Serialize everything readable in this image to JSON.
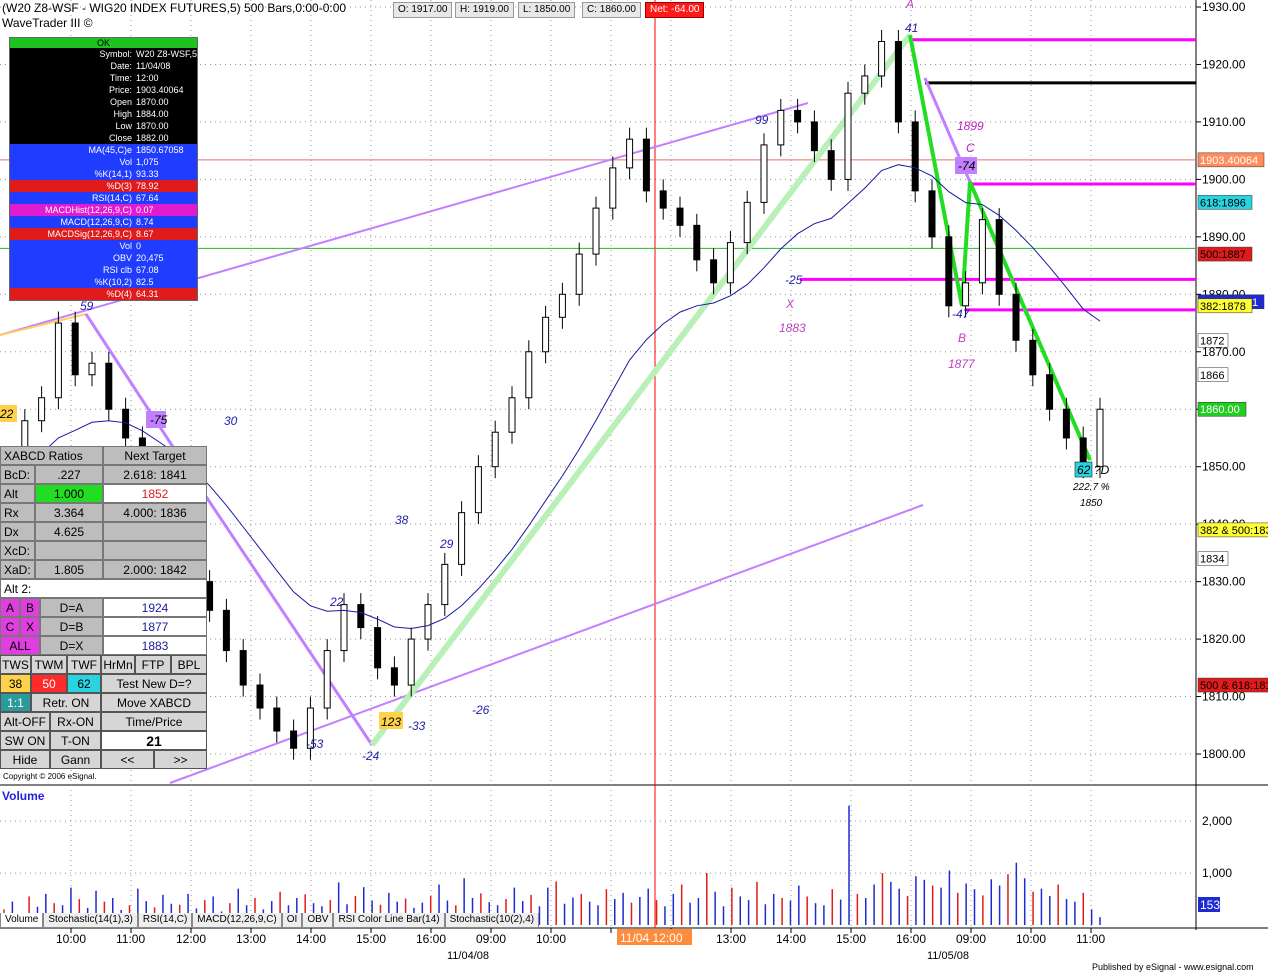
{
  "header": {
    "title": "(W20 Z8-WSF - WIG20 INDEX FUTURES,5) 500 Bars,0:00-0:00",
    "subtitle": "WaveTrader III ©",
    "open": "O: 1917.00",
    "high": "H: 1919.00",
    "low": "L: 1850.00",
    "close": "C: 1860.00",
    "net": "Net: -64.00"
  },
  "data_window": {
    "status": "OK",
    "rows": [
      {
        "k": "Symbol:",
        "v": "W20 Z8-WSF,5",
        "bg": "#000",
        "fg": "#fff"
      },
      {
        "k": "Date:",
        "v": "11/04/08",
        "bg": "#000",
        "fg": "#fff"
      },
      {
        "k": "Time:",
        "v": "12:00",
        "bg": "#000",
        "fg": "#fff"
      },
      {
        "k": "Price:",
        "v": "1903.40064",
        "bg": "#000",
        "fg": "#fff"
      },
      {
        "k": "Open",
        "v": "1870.00",
        "bg": "#000",
        "fg": "#fff"
      },
      {
        "k": "High",
        "v": "1884.00",
        "bg": "#000",
        "fg": "#fff"
      },
      {
        "k": "Low",
        "v": "1870.00",
        "bg": "#000",
        "fg": "#fff"
      },
      {
        "k": "Close",
        "v": "1882.00",
        "bg": "#000",
        "fg": "#fff"
      },
      {
        "k": "MA(45,C)e",
        "v": "1850.67058",
        "bg": "#1f3cff",
        "fg": "#fff"
      },
      {
        "k": "Vol",
        "v": "1,075",
        "bg": "#1f3cff",
        "fg": "#fff"
      },
      {
        "k": "%K(14,1)",
        "v": "93.33",
        "bg": "#1f3cff",
        "fg": "#fff"
      },
      {
        "k": "%D(3)",
        "v": "78.92",
        "bg": "#e01b1b",
        "fg": "#fff"
      },
      {
        "k": "RSI(14,C)",
        "v": "67.64",
        "bg": "#1f3cff",
        "fg": "#fff"
      },
      {
        "k": "MACDHist(12,26,9,C)",
        "v": "0.07",
        "bg": "#e01bd0",
        "fg": "#fff"
      },
      {
        "k": "MACD(12,26,9,C)",
        "v": "8.74",
        "bg": "#1f3cff",
        "fg": "#fff"
      },
      {
        "k": "MACDSig(12,26,9,C)",
        "v": "8.67",
        "bg": "#e01b1b",
        "fg": "#fff"
      },
      {
        "k": "Vol",
        "v": "0",
        "bg": "#1f3cff",
        "fg": "#fff"
      },
      {
        "k": "OBV",
        "v": "20,475",
        "bg": "#1f3cff",
        "fg": "#fff"
      },
      {
        "k": "RSI clb",
        "v": "67.08",
        "bg": "#1f3cff",
        "fg": "#fff"
      },
      {
        "k": "%K(10,2)",
        "v": "82.5",
        "bg": "#1f3cff",
        "fg": "#fff"
      },
      {
        "k": "%D(4)",
        "v": "64.31",
        "bg": "#e01b1b",
        "fg": "#fff"
      }
    ]
  },
  "xabcd": {
    "header_left": "XABCD Ratios",
    "header_right": "Next Target",
    "rows": [
      {
        "label": "BcD:",
        "val": ".227",
        "tgt": "2.618: 1841"
      },
      {
        "label": "Alt",
        "val": "1.000",
        "tgt": "1852"
      },
      {
        "label": "Rx",
        "val": "3.364",
        "tgt": "4.000: 1836"
      },
      {
        "label": "Dx",
        "val": "4.625",
        "tgt": ""
      },
      {
        "label": "XcD:",
        "val": "",
        "tgt": ""
      },
      {
        "label": "XaD:",
        "val": "1.805",
        "tgt": "2.000: 1842"
      }
    ],
    "alt2": "Alt 2:",
    "da_btn1": "A",
    "da_btn2": "B",
    "da_label": "D=A",
    "da_val": "1924",
    "db_btn1": "C",
    "db_btn2": "X",
    "db_label": "D=B",
    "db_val": "1877",
    "dx_btn1": "ALL",
    "dx_label": "D=X",
    "dx_val": "1883",
    "tabs": [
      "TWS",
      "TWM",
      "TWF",
      "HrMn",
      "FTP",
      "BPL"
    ],
    "n38": "38",
    "n50": "50",
    "n62": "62",
    "test_new": "Test New D=?",
    "ratio11": "1:1",
    "retr_on": "Retr. ON",
    "move_xabcd": "Move XABCD",
    "alt_off": "Alt-OFF",
    "rx_on": "Rx-ON",
    "time_price": "Time/Price",
    "sw_on": "SW ON",
    "t_on": "T-ON",
    "counter": "21",
    "hide": "Hide",
    "gann": "Gann",
    "prev": "<<",
    "next": ">>",
    "copyright": "Copyright © 2006 eSignal."
  },
  "chart_data": {
    "type": "line",
    "subtype": "candlestick",
    "title": "(W20 Z8-WSF - WIG20 INDEX FUTURES,5) 500 Bars,0:00-0:00",
    "ylim": [
      1795,
      1932
    ],
    "y_ticks": [
      "1930.00",
      "1920.00",
      "1910.00",
      "1900.00",
      "1890.00",
      "1880.00",
      "1870.00",
      "1860.00",
      "1850.00",
      "1840.00",
      "1830.00",
      "1820.00",
      "1810.00",
      "1800.00"
    ],
    "x_ticks": [
      "10:00",
      "11:00",
      "12:00",
      "13:00",
      "14:00",
      "15:00",
      "16:00",
      "09:00",
      "10:00",
      "11:00",
      "12:00",
      "13:00",
      "14:00",
      "15:00",
      "16:00",
      "09:00",
      "10:00",
      "11:00"
    ],
    "x_dates": [
      "11/04/08",
      "11/05/08"
    ],
    "cursor_time": "11/04 12:00",
    "price_labels": [
      {
        "text": "1903.40064",
        "price": 1903.4,
        "bg": "#ff8c5a",
        "fg": "#fff"
      },
      {
        "text": "618:1896",
        "price": 1896,
        "bg": "#2ad3e0",
        "fg": "#000"
      },
      {
        "text": "500:1887",
        "price": 1887,
        "bg": "#e01b1b",
        "fg": "#000"
      },
      {
        "text": "1878.67261",
        "price": 1878.7,
        "bg": "#1f2bd0",
        "fg": "#fff"
      },
      {
        "text": "382:1878",
        "price": 1878,
        "bg": "#ffff33",
        "fg": "#000"
      },
      {
        "text": "1872",
        "price": 1872,
        "bg": "#fff",
        "fg": "#000"
      },
      {
        "text": "1866",
        "price": 1866,
        "bg": "#fff",
        "fg": "#000"
      },
      {
        "text": "1860.00",
        "price": 1860,
        "bg": "#22cc22",
        "fg": "#fff"
      },
      {
        "text": "382 & 500:1839",
        "price": 1839,
        "bg": "#ffff33",
        "fg": "#000"
      },
      {
        "text": "1834",
        "price": 1834,
        "bg": "#fff",
        "fg": "#000"
      },
      {
        "text": "500 & 618:1812",
        "price": 1812,
        "bg": "#e01b1b",
        "fg": "#000"
      }
    ],
    "wave_labels": [
      "A",
      "41",
      "99",
      "1899",
      "C",
      "-74",
      "-25",
      "X",
      "1883",
      "-47",
      "B",
      "1877",
      "59",
      "-75",
      "30",
      "22",
      "38",
      "29",
      "-53",
      "-24",
      "-33",
      "-26",
      "?D",
      "222.7 %",
      "1850",
      "62",
      "22",
      "123"
    ],
    "series": [
      {
        "values": [
          1850,
          1858,
          1862,
          1875,
          1866,
          1868,
          1860,
          1855,
          1846,
          1840,
          1838,
          1830,
          1825,
          1818,
          1812,
          1808,
          1804,
          1801,
          1808,
          1818,
          1826,
          1822,
          1815,
          1812,
          1820,
          1826,
          1833,
          1842,
          1850,
          1856,
          1862,
          1870,
          1876,
          1880,
          1887,
          1895,
          1902,
          1907,
          1898,
          1895,
          1892,
          1886,
          1882,
          1889,
          1896,
          1906,
          1912,
          1910,
          1905,
          1900,
          1915,
          1918,
          1924,
          1910,
          1898,
          1890,
          1878,
          1882,
          1893,
          1880,
          1872,
          1866,
          1860,
          1855,
          1850,
          1860
        ]
      }
    ],
    "volume": {
      "title": "Volume",
      "y_ticks": [
        "2,000",
        "1,000"
      ],
      "ylim": [
        0,
        2600
      ],
      "last": "153",
      "values": [
        300,
        450,
        200,
        550,
        350,
        600,
        420,
        380,
        720,
        500,
        330,
        660,
        450,
        520,
        290,
        380,
        700,
        460,
        340,
        580,
        410,
        390,
        600,
        320,
        480,
        550,
        260,
        420,
        700,
        380,
        520,
        300,
        460,
        640,
        380,
        520,
        590,
        420,
        360,
        480,
        820,
        400,
        560,
        730,
        470,
        390,
        620,
        450,
        510,
        330,
        430,
        560,
        780,
        470,
        380,
        900,
        520,
        610,
        440,
        380,
        500,
        720,
        460,
        580,
        360,
        720,
        840,
        410,
        530,
        600,
        450,
        380,
        690,
        500,
        620,
        430,
        540,
        700,
        480,
        360,
        600,
        780,
        430,
        520,
        1000,
        640,
        360,
        720,
        550,
        480,
        830,
        400,
        600,
        520,
        470,
        760,
        550,
        420,
        380,
        690,
        490,
        2300,
        600,
        520,
        780,
        1000,
        830,
        700,
        560,
        940,
        870,
        760,
        720,
        1050,
        620,
        800,
        690,
        570,
        880,
        760,
        980,
        1200,
        900,
        640,
        700,
        560,
        780,
        500,
        450,
        620,
        300,
        150
      ]
    },
    "tabs": [
      "Volume",
      "Stochastic(14(1),3)",
      "RSI(14,C)",
      "MACD(12,26,9,C)",
      "OI",
      "OBV",
      "RSI Color Line Bar(14)",
      "Stochastic(10(2),4)"
    ],
    "published": "Published by eSignal - www.esignal.com"
  },
  "colors": {
    "wave_green": "#22dd22",
    "wave_purple": "#c080ff",
    "fib_magenta": "#ff00ff",
    "ma_blue": "#1a1aa0",
    "vline_red": "#ff0000",
    "green_line": "#22bb22"
  }
}
